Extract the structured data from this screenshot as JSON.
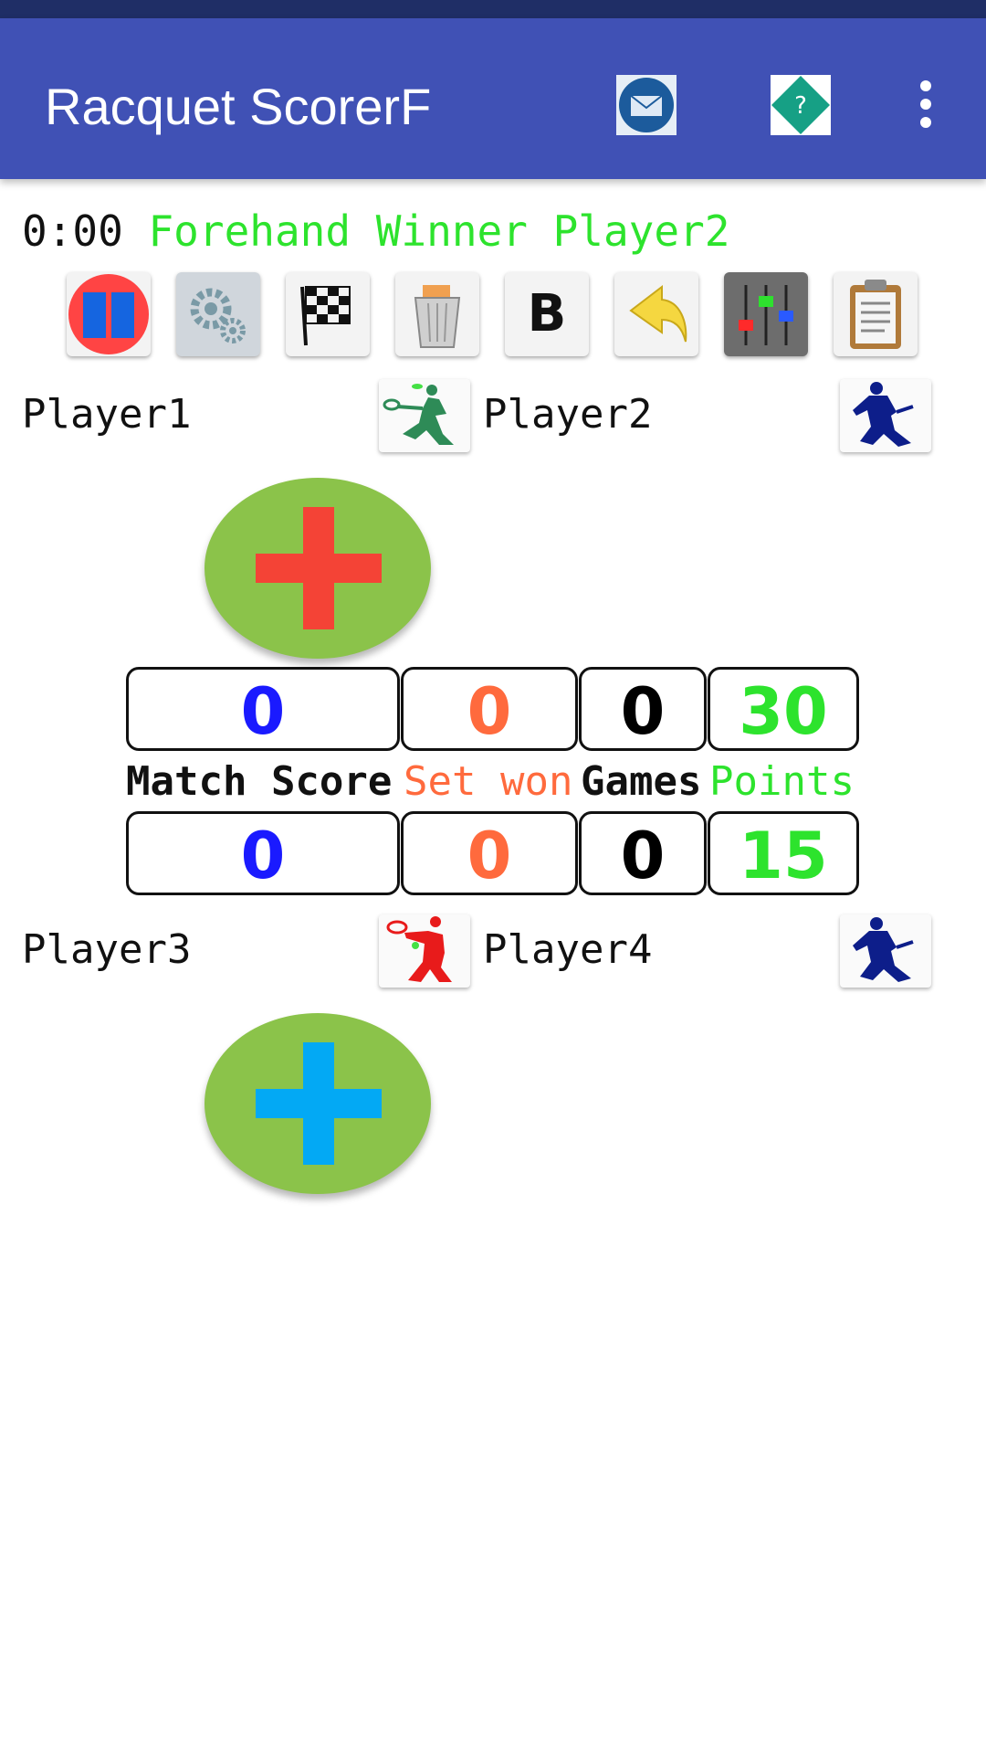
{
  "app": {
    "title": "Racquet ScorerF"
  },
  "status": {
    "time": "0:00",
    "event": "Forehand Winner Player2"
  },
  "toolbar": {
    "bold_label": "B"
  },
  "players": {
    "p1": "Player1",
    "p2": "Player2",
    "p3": "Player3",
    "p4": "Player4"
  },
  "headers": {
    "match": "Match Score",
    "set": "Set won",
    "games": "Games",
    "points": "Points"
  },
  "team1": {
    "match": "0",
    "set": "0",
    "games": "0",
    "points": "30"
  },
  "team2": {
    "match": "0",
    "set": "0",
    "games": "0",
    "points": "15"
  },
  "colors": {
    "appbar": "#4051b5",
    "match": "#1a1aff",
    "set": "#ff6a3d",
    "games": "#000000",
    "points": "#2de32d",
    "plus_bg": "#8bc34a",
    "plus_team1": "#f44336",
    "plus_team2": "#03a9f4"
  }
}
